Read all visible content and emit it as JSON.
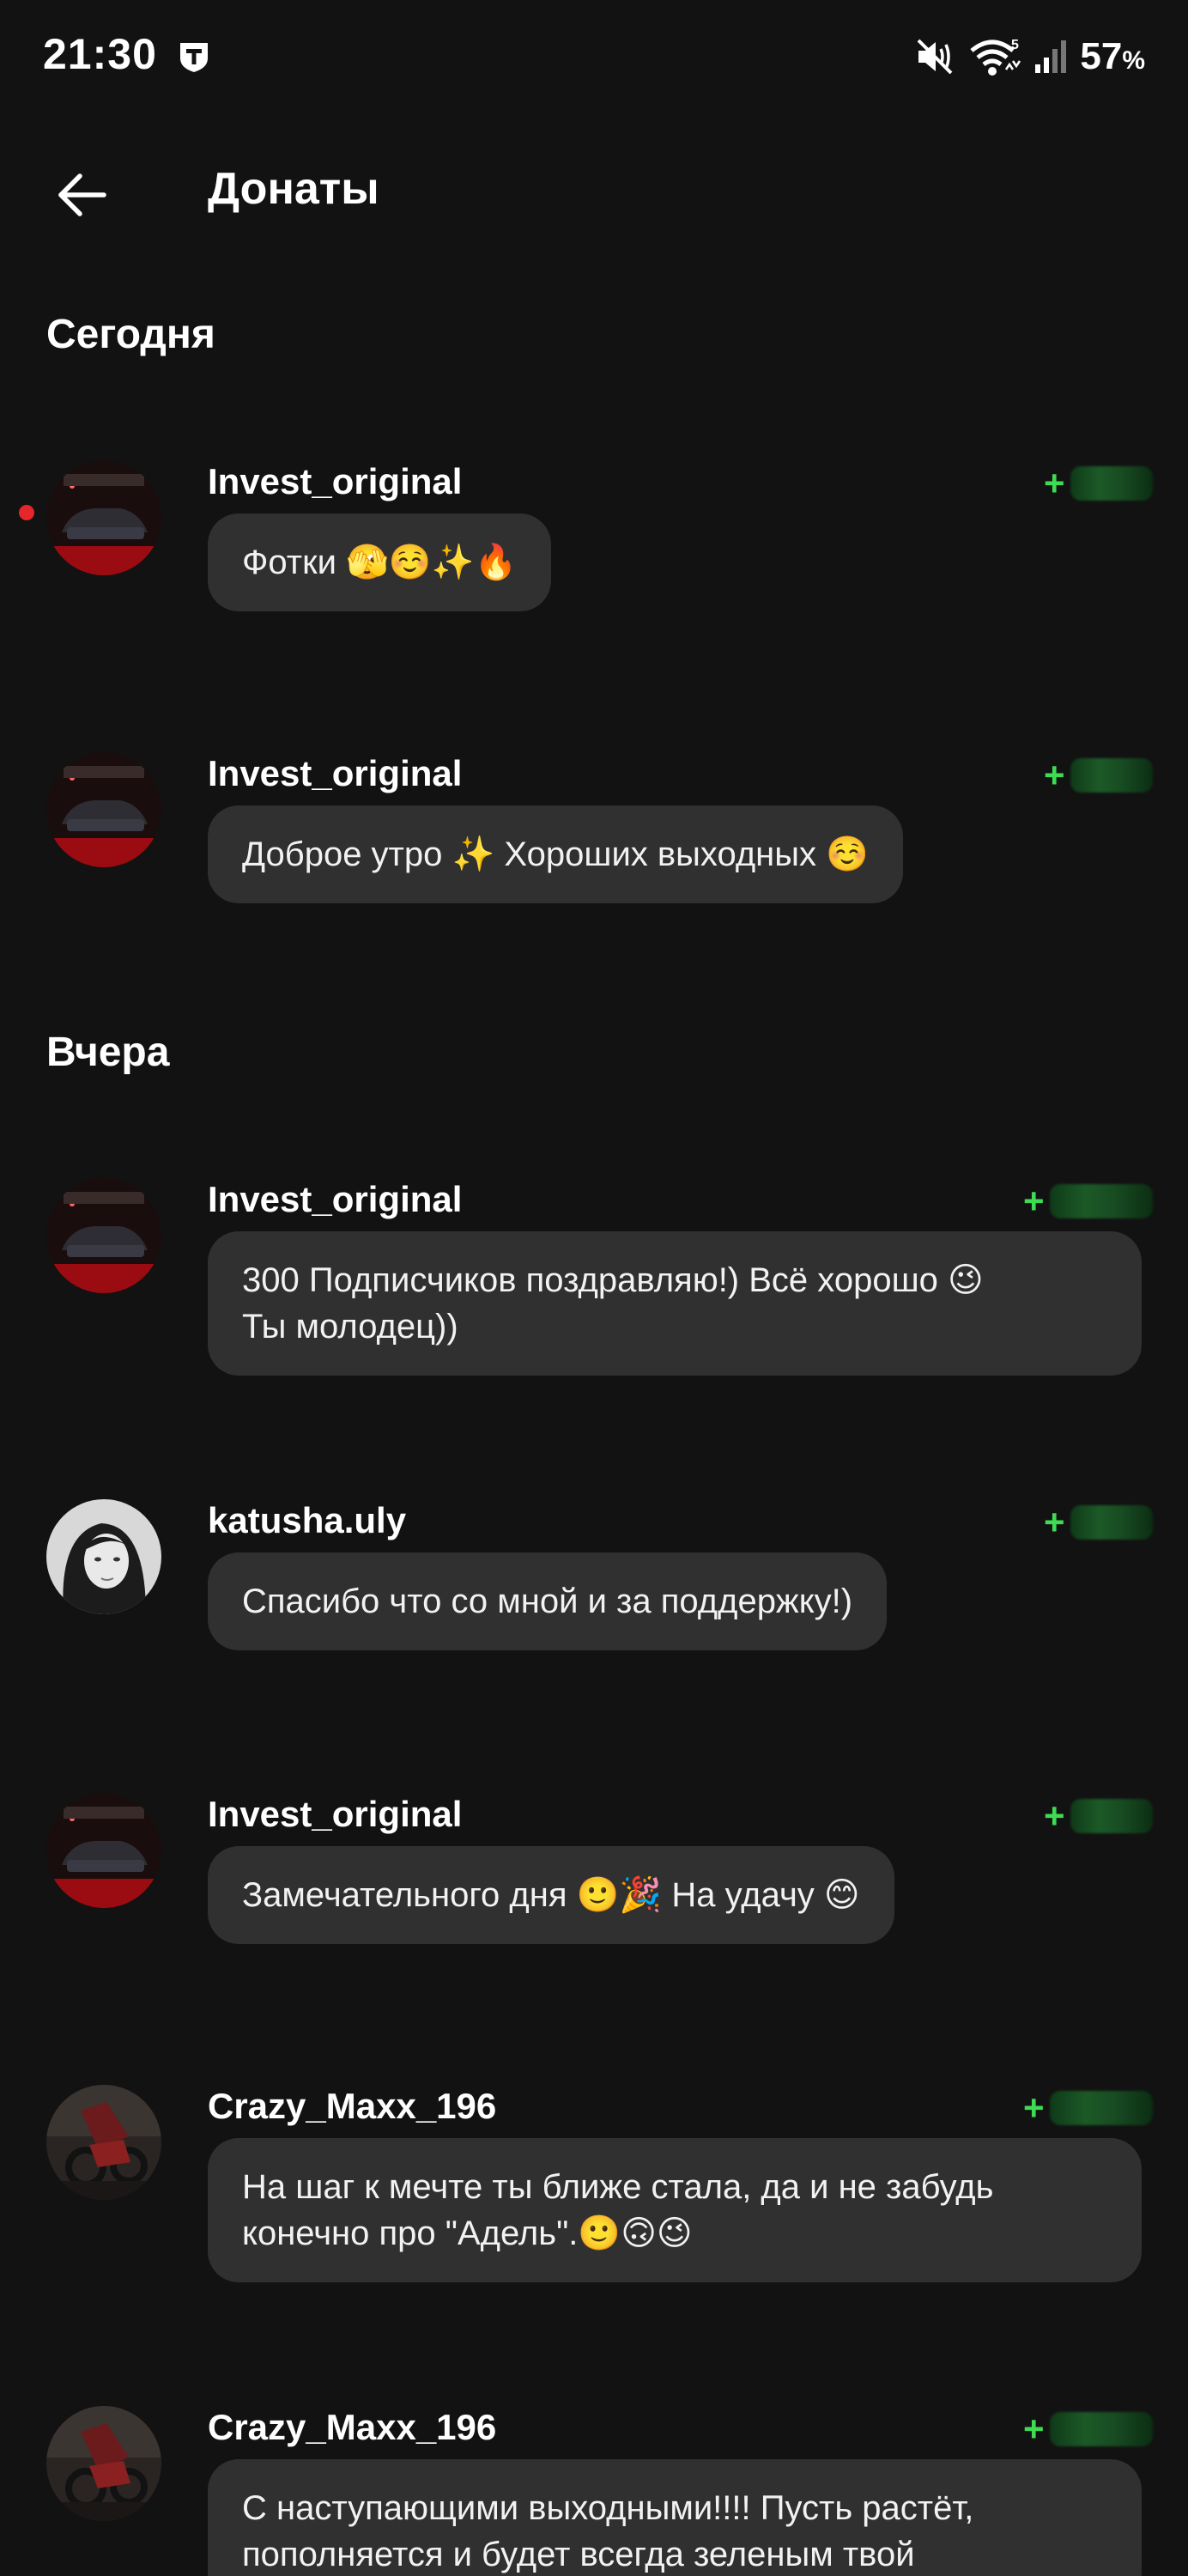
{
  "status_bar": {
    "time": "21:30",
    "battery": "57",
    "battery_unit": "%",
    "network": "5"
  },
  "header": {
    "title": "Донаты"
  },
  "sections": [
    {
      "title": "Сегодня"
    },
    {
      "title": "Вчера"
    }
  ],
  "donations": [
    {
      "username": "Invest_original",
      "amount_sign": "+",
      "message": "Фотки 🫣☺️✨🔥",
      "avatar": "car-red-avatar",
      "unread": true
    },
    {
      "username": "Invest_original",
      "amount_sign": "+",
      "message": "Доброе утро ✨ Хороших выходных ☺️",
      "avatar": "car-red-avatar"
    },
    {
      "username": "Invest_original",
      "amount_sign": "+",
      "message": "300 Подписчиков поздравляю!) Всё хорошо 😉\nТы молодец))",
      "avatar": "car-red-avatar"
    },
    {
      "username": "katusha.uly",
      "amount_sign": "+",
      "message": "Спасибо что со мной и за поддержку!)",
      "avatar": "woman-portrait-avatar"
    },
    {
      "username": "Invest_original",
      "amount_sign": "+",
      "message": "Замечательного дня 🙂🎉 На удачу 😊",
      "avatar": "car-red-avatar"
    },
    {
      "username": "Crazy_Maxx_196",
      "amount_sign": "+",
      "message": "На шаг к мечте ты ближе стала, да и не забудь\nконечно про \"Адель\".🙂🙃😉",
      "avatar": "motorcycle-avatar"
    },
    {
      "username": "Crazy_Maxx_196",
      "amount_sign": "+",
      "message": "С наступающими выходными!!!! Пусть растёт,\nпополняется и будет всегда зеленым твой",
      "avatar": "motorcycle-avatar"
    }
  ]
}
